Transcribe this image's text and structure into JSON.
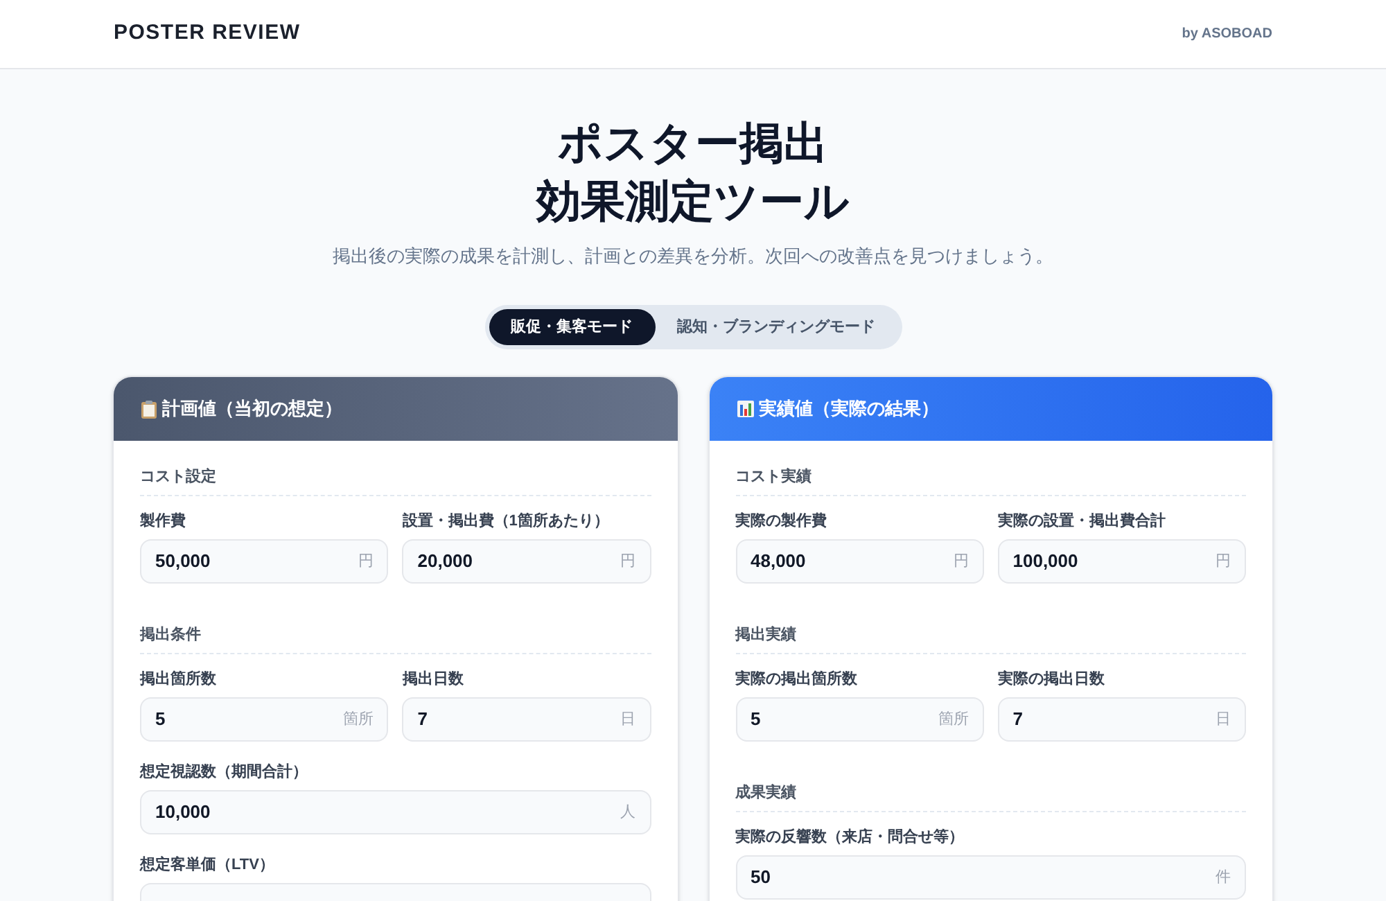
{
  "header": {
    "title": "POSTER REVIEW",
    "byline": "by ASOBOAD"
  },
  "hero": {
    "title_lines": [
      "ポスター掲出",
      "効果測定ツール"
    ],
    "subtitle": "掲出後の実際の成果を計測し、計画との差異を分析。次回への改善点を見つけましょう。"
  },
  "mode_tabs": [
    {
      "label": "販促・集客モード",
      "selected": true
    },
    {
      "label": "認知・ブランディングモード",
      "selected": false
    }
  ],
  "panels": [
    {
      "kind": "plan",
      "title": "計画値（当初の想定）",
      "sections": [
        {
          "title": "コスト設定",
          "rows": [
            [
              {
                "label": "製作費",
                "value": "50,000",
                "unit": "円"
              },
              {
                "label": "設置・掲出費（1箇所あたり）",
                "value": "20,000",
                "unit": "円"
              }
            ]
          ]
        },
        {
          "title": "掲出条件",
          "rows": [
            [
              {
                "label": "掲出箇所数",
                "value": "5",
                "unit": "箇所"
              },
              {
                "label": "掲出日数",
                "value": "7",
                "unit": "日"
              }
            ],
            [
              {
                "label": "想定視認数（期間合計）",
                "value": "10,000",
                "unit": "人"
              }
            ],
            [
              {
                "label": "想定客単価（LTV）"
              }
            ]
          ]
        }
      ]
    },
    {
      "kind": "actual",
      "title": "実績値（実際の結果）",
      "sections": [
        {
          "title": "コスト実績",
          "rows": [
            [
              {
                "label": "実際の製作費",
                "value": "48,000",
                "unit": "円"
              },
              {
                "label": "実際の設置・掲出費合計",
                "value": "100,000",
                "unit": "円"
              }
            ]
          ]
        },
        {
          "title": "掲出実績",
          "rows": [
            [
              {
                "label": "実際の掲出箇所数",
                "value": "5",
                "unit": "箇所"
              },
              {
                "label": "実際の掲出日数",
                "value": "7",
                "unit": "日"
              }
            ]
          ]
        },
        {
          "title": "成果実績",
          "rows": [
            [
              {
                "label": "実際の反響数（来店・問合せ等）",
                "value": "50",
                "unit": "件"
              }
            ]
          ]
        }
      ]
    }
  ]
}
